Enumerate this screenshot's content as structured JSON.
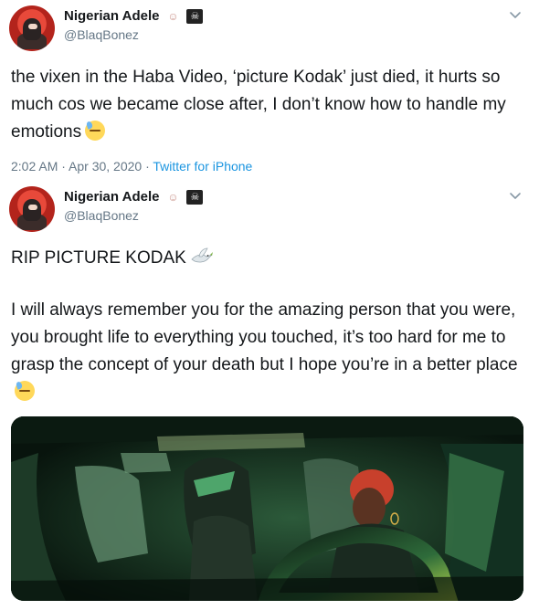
{
  "tweets": [
    {
      "author_name": "Nigerian Adele",
      "author_handle": "@BlaqBonez",
      "badges": [
        "baby-angel-emoji",
        "skull-crossbones-emoji"
      ],
      "text": "the vixen in the Haba Video, ‘picture Kodak’ just died, it hurts so much cos we became close after, I don’t know how to handle my emotions",
      "text_emoji": "downcast-face-with-sweat",
      "timestamp": "2:02 AM · Apr 30, 2020 · ",
      "source": "Twitter for iPhone"
    },
    {
      "author_name": "Nigerian Adele",
      "author_handle": "@BlaqBonez",
      "badges": [
        "baby-angel-emoji",
        "skull-crossbones-emoji"
      ],
      "headline": "RIP PICTURE KODAK",
      "headline_emoji": "dove",
      "text": "I will always remember you for the amazing person that you were, you brought life to everything you touched, it’s too hard for me to grasp the concept of your death but I hope you’re in a better place",
      "text_emoji": "downcast-face-with-sweat",
      "media": "photo"
    }
  ],
  "colors": {
    "text": "#14171a",
    "secondary": "#657786",
    "link": "#1b95e0",
    "background": "#ffffff"
  }
}
